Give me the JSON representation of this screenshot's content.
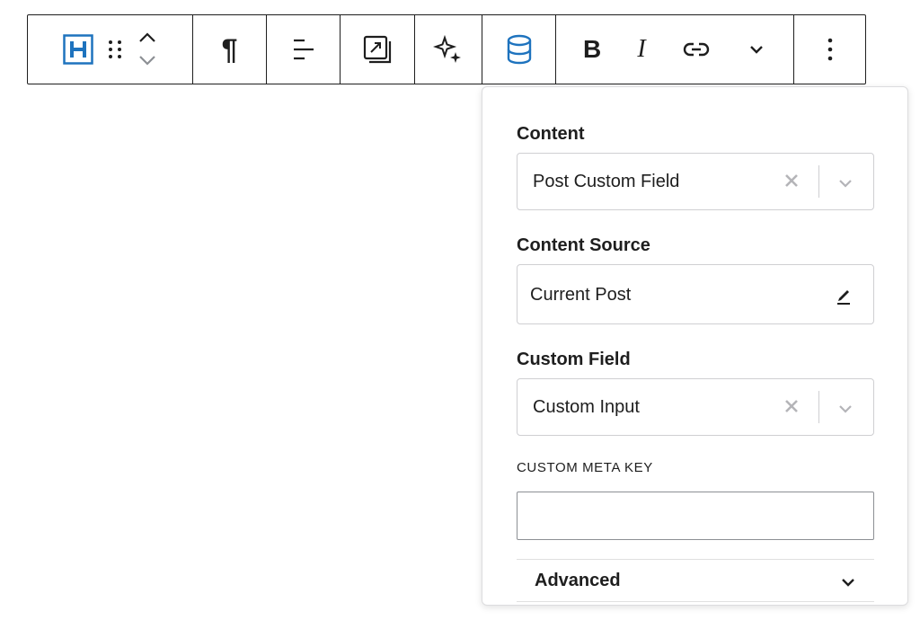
{
  "toolbar": {
    "icons": [
      "heading-icon",
      "drag-handle-icon",
      "move-up-down-icon",
      "paragraph-icon",
      "align-icon",
      "resize-icon",
      "sparkle-icon",
      "database-icon",
      "bold-icon",
      "italic-icon",
      "link-icon",
      "chevron-down-icon",
      "more-options-icon"
    ],
    "bold_label": "B",
    "italic_label": "I",
    "paragraph_label": "¶",
    "accent_color": "#1e73be"
  },
  "popover": {
    "content_label": "Content",
    "content_value": "Post Custom Field",
    "source_label": "Content Source",
    "source_value": "Current Post",
    "field_label": "Custom Field",
    "field_value": "Custom Input",
    "meta_key_label": "CUSTOM META KEY",
    "meta_key_value": "",
    "advanced_label": "Advanced"
  }
}
